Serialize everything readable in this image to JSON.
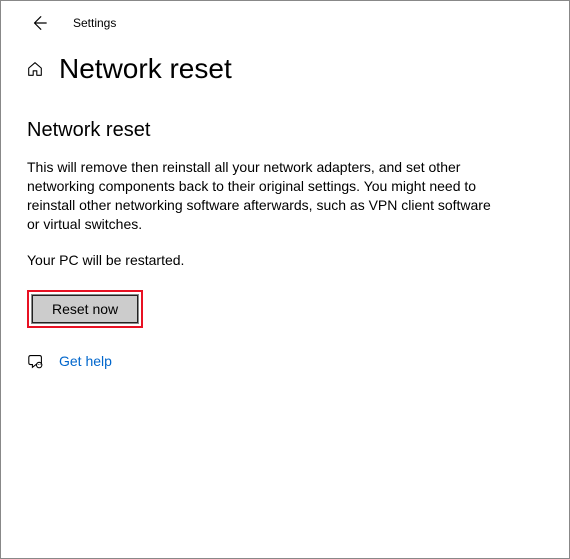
{
  "header": {
    "title": "Settings"
  },
  "page": {
    "title": "Network reset"
  },
  "section": {
    "heading": "Network reset",
    "description": "This will remove then reinstall all your network adapters, and set other networking components back to their original settings. You might need to reinstall other networking software afterwards, such as VPN client software or virtual switches.",
    "restart_notice": "Your PC will be restarted.",
    "reset_button": "Reset now"
  },
  "help": {
    "label": "Get help"
  }
}
